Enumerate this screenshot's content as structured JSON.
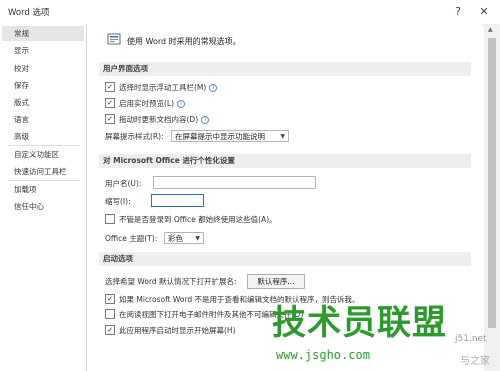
{
  "window": {
    "title": "Word 选项",
    "help": "?",
    "close": "✕"
  },
  "sidebar": {
    "items": [
      {
        "label": "常规",
        "active": true
      },
      {
        "label": "显示"
      },
      {
        "label": "校对"
      },
      {
        "label": "保存"
      },
      {
        "label": "版式"
      },
      {
        "label": "语言"
      },
      {
        "label": "高级"
      },
      {
        "label": "自定义功能区"
      },
      {
        "label": "快速访问工具栏"
      },
      {
        "label": "加载项"
      },
      {
        "label": "信任中心"
      }
    ]
  },
  "main": {
    "intro": "使用 Word 时采用的常规选项。",
    "ui_section": {
      "title": "用户界面选项",
      "mini_toolbar": "选择时显示浮动工具栏(M)",
      "live_preview": "启用实时预览(L)",
      "update_drag": "拖动时更新文档内容(D)",
      "tooltip_label": "屏幕提示样式(R):",
      "tooltip_value": "在屏幕提示中显示功能说明"
    },
    "personalize": {
      "title": "对 Microsoft Office 进行个性化设置",
      "username_label": "用户名(U):",
      "username_value": "",
      "initials_label": "缩写(I):",
      "initials_value": "",
      "always_use": "不管是否登录到 Office 都始终使用这些值(A)。",
      "theme_label": "Office 主题(T):",
      "theme_value": "彩色"
    },
    "startup": {
      "title": "启动选项",
      "default_ext": "选择希望 Word 默认情况下打开扩展名:",
      "default_programs_btn": "默认程序...",
      "not_default": "如果 Microsoft Word 不是用于查看和编辑文档的默认程序，则告诉我。",
      "open_attachments": "在阅读视图下打开电子邮件附件及其他不可编辑文件(O)",
      "show_start": "此应用程序启动时显示开始屏幕(H)"
    }
  },
  "watermark": {
    "main": "技术员联盟",
    "url": "www.jsgho.com",
    "side1": "j51.net",
    "side2": "与之家"
  },
  "colors": {
    "accent": "#2b6cc4",
    "section_bg": "#eeeeee",
    "watermark": "#2e9a2e"
  }
}
